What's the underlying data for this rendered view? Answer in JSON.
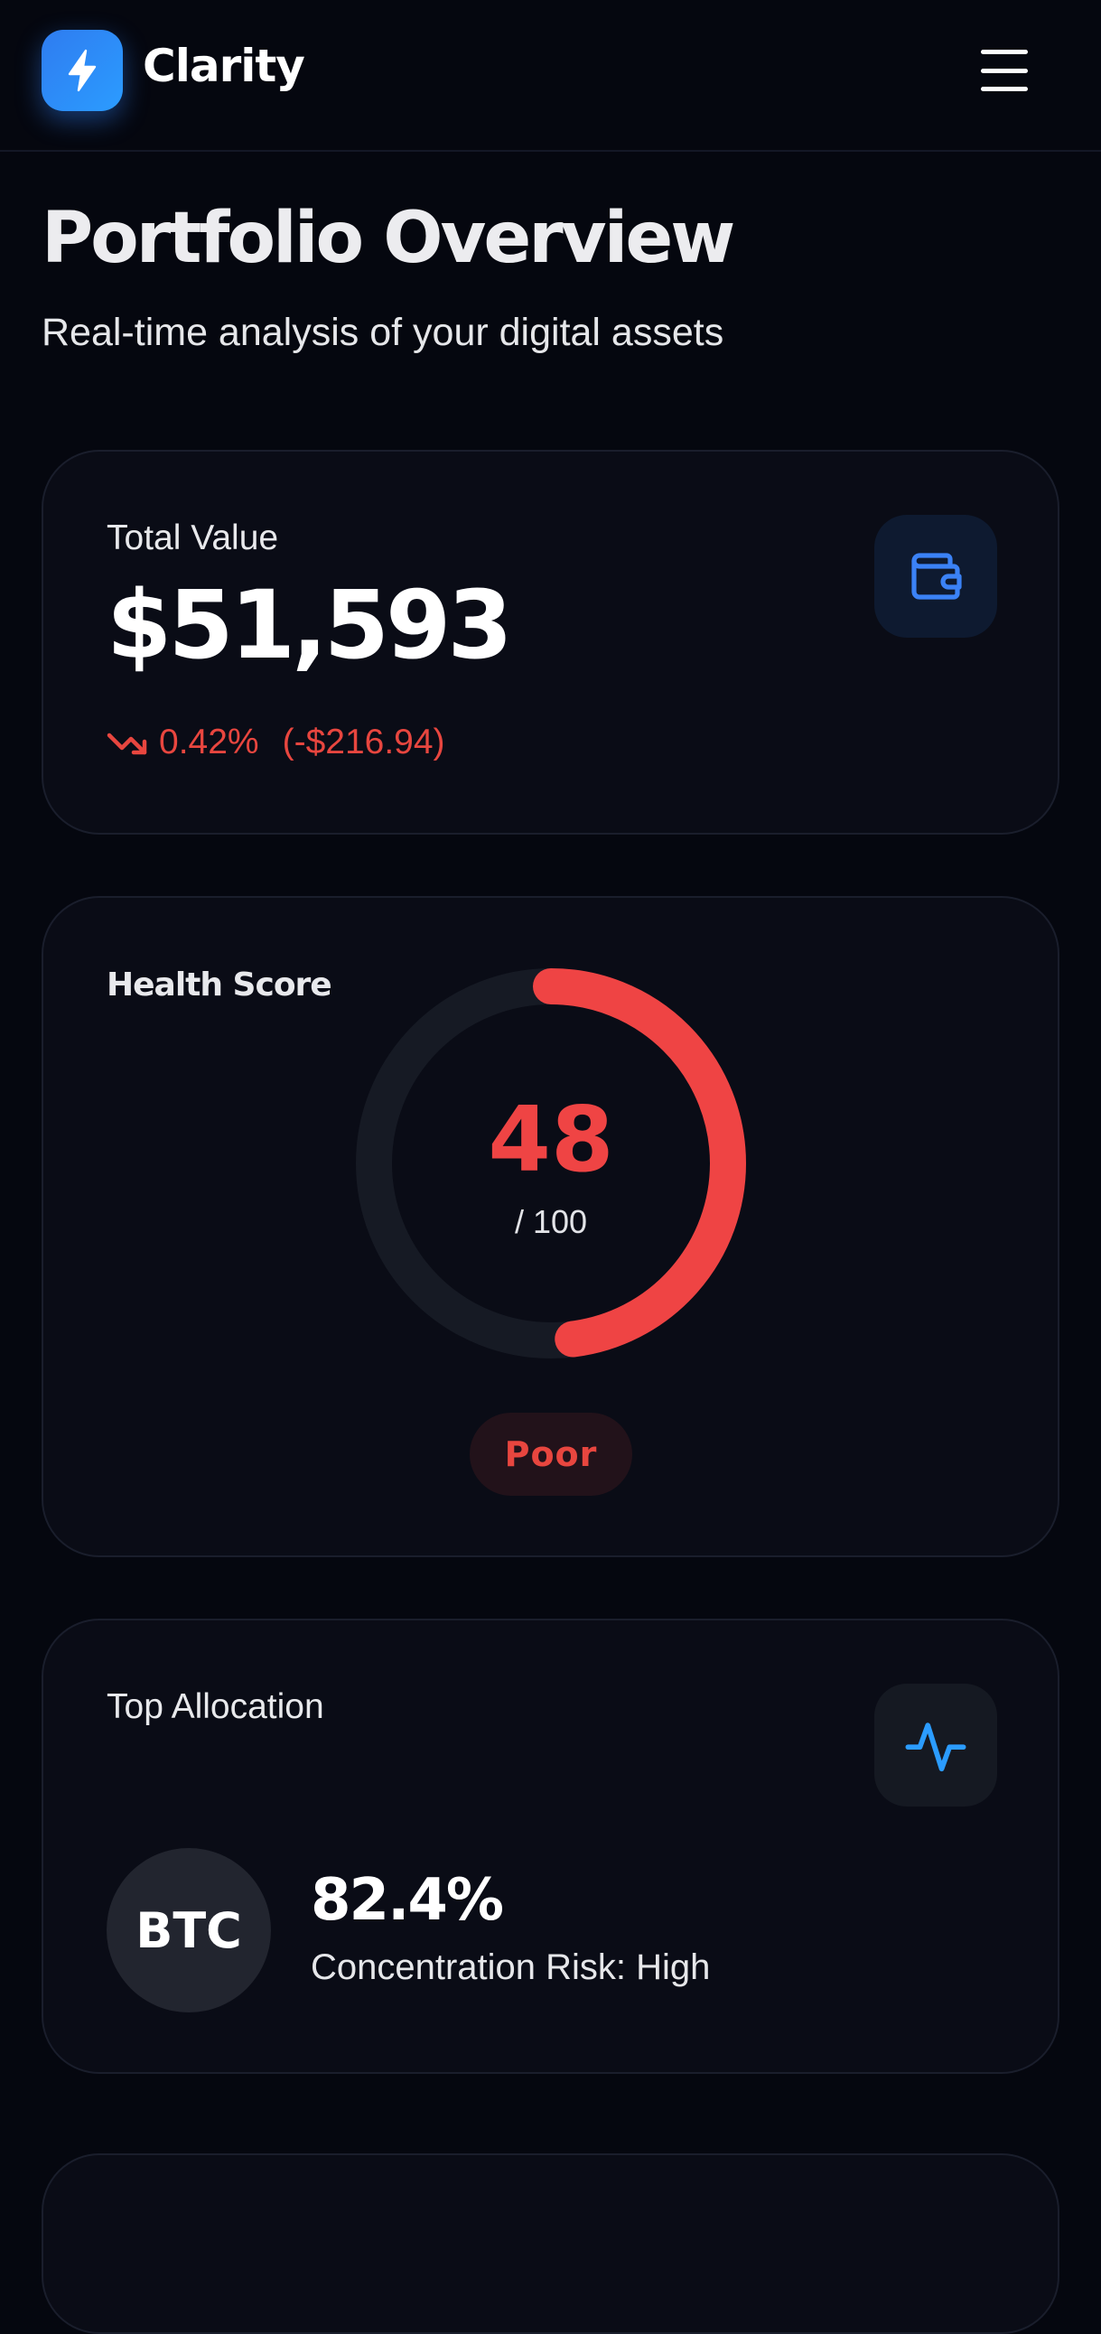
{
  "header": {
    "brand": "Clarity",
    "brand_color": "#2f7cf0",
    "logo_icon": "lightning-bolt-icon",
    "menu_icon": "hamburger-menu-icon"
  },
  "page": {
    "title": "Portfolio Overview",
    "subtitle": "Real-time analysis of your digital assets"
  },
  "total_value": {
    "label": "Total Value",
    "value": "$51,593",
    "change_percent": "0.42%",
    "change_amount": "(-$216.94)",
    "trend": "down",
    "trend_color": "#e8463f",
    "icon": "wallet-icon"
  },
  "health": {
    "label": "Health Score",
    "score": "48",
    "max": "/ 100",
    "score_fraction": 0.48,
    "status": "Poor",
    "color": "#ef4444"
  },
  "allocation": {
    "label": "Top Allocation",
    "asset": "BTC",
    "percent": "82.4%",
    "risk": "Concentration Risk: High",
    "icon": "pulse-activity-icon"
  }
}
